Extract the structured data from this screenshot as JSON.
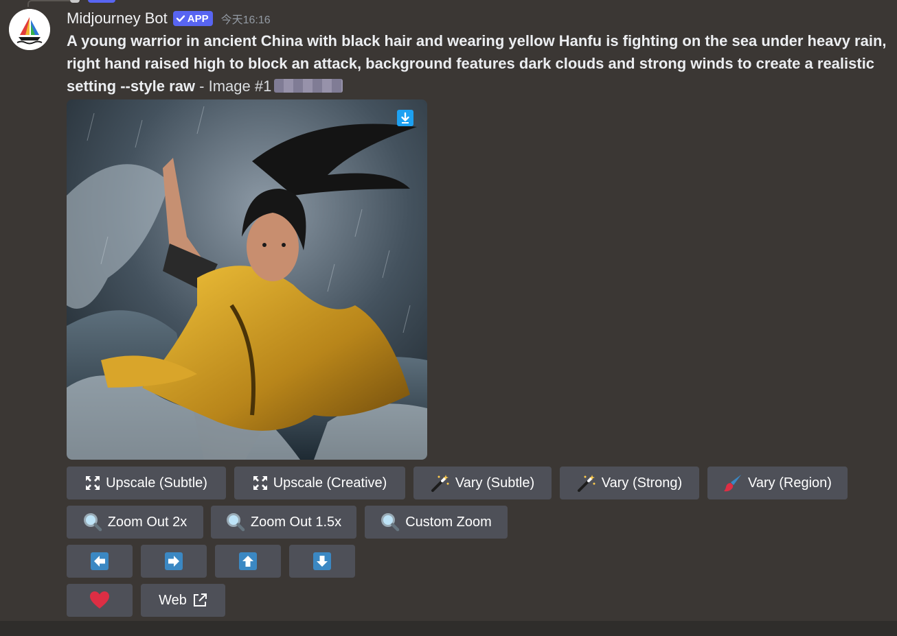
{
  "message": {
    "username": "Midjourney Bot",
    "badge": "APP",
    "timestamp": "今天16:16",
    "prompt_bold": "A young warrior in ancient China with black hair and wearing yellow Hanfu is fighting on the sea under heavy rain, right hand raised high to block an attack, background features dark clouds and strong winds to create a realistic setting --style raw",
    "prompt_suffix": " - Image #1"
  },
  "icons": {
    "upscale": "expand-arrows-icon",
    "vary": "magic-wand-icon",
    "vary_region": "paintbrush-icon",
    "zoom": "magnifier-icon",
    "pan": "arrow-icon",
    "like": "heart-icon",
    "external": "external-link-icon",
    "download": "download-icon"
  },
  "buttons": {
    "upscale_subtle": "Upscale (Subtle)",
    "upscale_creative": "Upscale (Creative)",
    "vary_subtle": "Vary (Subtle)",
    "vary_strong": "Vary (Strong)",
    "vary_region": "Vary (Region)",
    "zoom_out_2x": "Zoom Out 2x",
    "zoom_out_1_5x": "Zoom Out 1.5x",
    "custom_zoom": "Custom Zoom",
    "web": "Web"
  },
  "colors": {
    "background": "#3b3734",
    "button": "#4e5058",
    "badge": "#5865f2",
    "arrow_icon": "#3b88c3",
    "heart": "#dd2e44"
  }
}
